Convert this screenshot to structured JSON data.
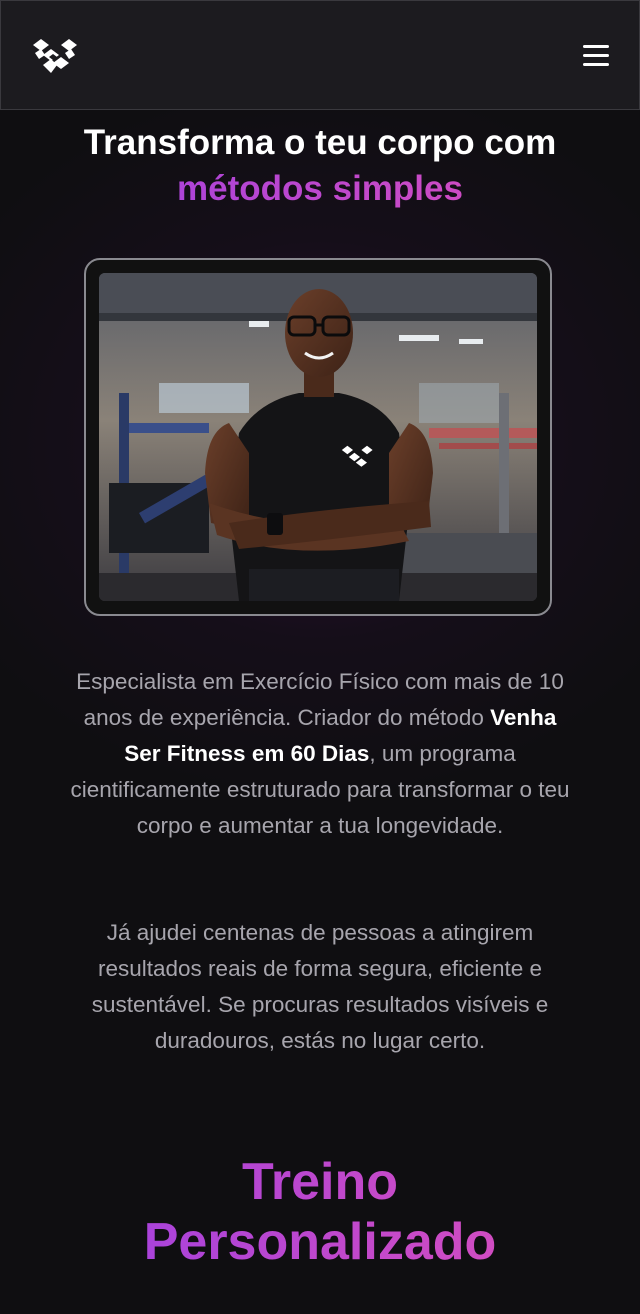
{
  "header": {
    "logo_icon": "brand-logo-icon",
    "menu_icon": "hamburger-menu-icon"
  },
  "hero": {
    "title_line1": "Transforma o teu corpo com",
    "title_line2": "métodos simples"
  },
  "photo": {
    "icon": "trainer-gym-photo"
  },
  "bio": {
    "p1_before": "Especialista em Exercício Físico com mais de 10 anos de experiência. Criador do método ",
    "p1_bold": "Venha Ser Fitness em 60 Dias",
    "p1_after": ", um programa cientificamente estruturado para transformar o teu corpo e aumentar a tua longevidade.",
    "p2": "Já ajudei centenas de pessoas a atingirem resultados reais de forma segura, eficiente e sustentável. Se procuras resultados visíveis e duradouros, estás no lugar certo."
  },
  "section": {
    "title_line1": "Treino",
    "title_line2": "Personalizado"
  },
  "colors": {
    "accent_start": "#9b3fe4",
    "accent_end": "#e050b8",
    "background": "#0f0e11",
    "header_bg": "#1c1b1f"
  }
}
